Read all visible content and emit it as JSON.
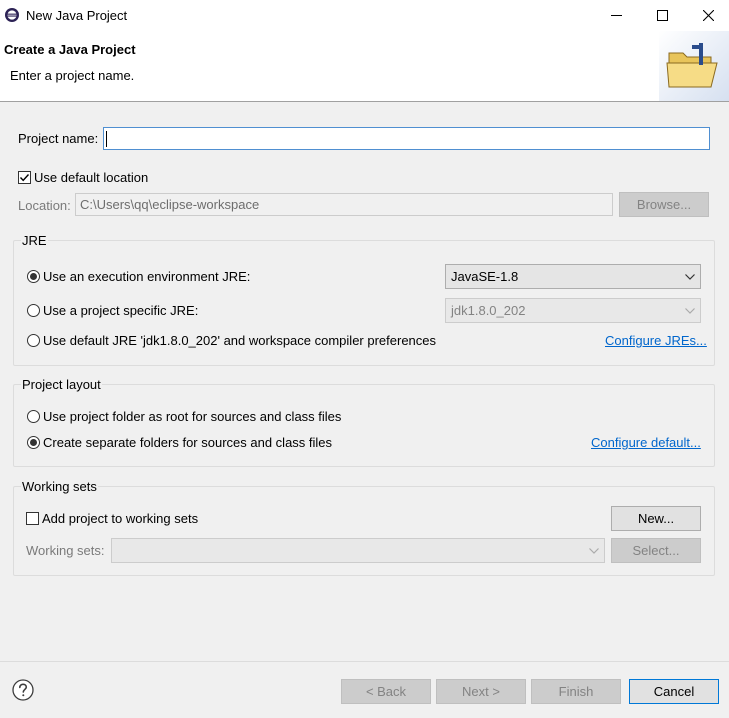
{
  "window": {
    "title": "New Java Project",
    "icon": "eclipse-icon"
  },
  "header": {
    "title": "Create a Java Project",
    "description": "Enter a project name.",
    "icon": "folder-wizard-icon"
  },
  "project": {
    "name_label": "Project name:",
    "name_value": ""
  },
  "location": {
    "use_default_label": "Use default location",
    "use_default_checked": true,
    "label": "Location:",
    "value": "C:\\Users\\qq\\eclipse-workspace",
    "browse_label": "Browse..."
  },
  "jre": {
    "title": "JRE",
    "option1": "Use an execution environment JRE:",
    "option1_value": "JavaSE-1.8",
    "option2": "Use a project specific JRE:",
    "option2_value": "jdk1.8.0_202",
    "option3": "Use default JRE 'jdk1.8.0_202' and workspace compiler preferences",
    "configure_link": "Configure JREs..."
  },
  "layout": {
    "title": "Project layout",
    "option1": "Use project folder as root for sources and class files",
    "option2": "Create separate folders for sources and class files",
    "configure_link": "Configure default..."
  },
  "working_sets": {
    "title": "Working sets",
    "add_label": "Add project to working sets",
    "new_label": "New...",
    "sets_label": "Working sets:",
    "select_label": "Select..."
  },
  "footer": {
    "back": "< Back",
    "next": "Next >",
    "finish": "Finish",
    "cancel": "Cancel"
  }
}
